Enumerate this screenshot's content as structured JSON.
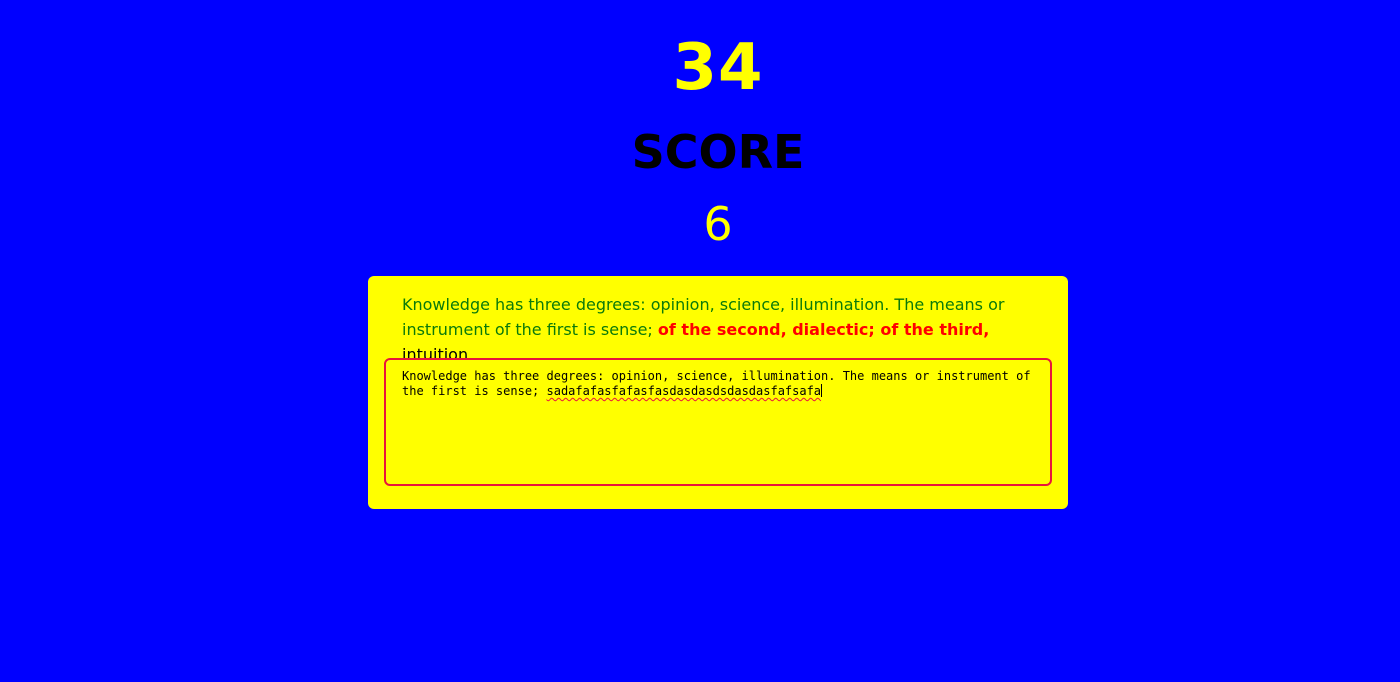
{
  "timer": {
    "value": "34"
  },
  "score": {
    "label": "SCORE",
    "value": "6"
  },
  "quote": {
    "correct_text": "Knowledge has three degrees: opinion, science, illumination. The means or instrument of the first is sense; ",
    "error_text": "of the second, dialectic; of the third,",
    "remaining_text": " intuition."
  },
  "input": {
    "typed_prefix": "Knowledge has three degrees: opinion, science, illumination. The means or instrument of the first is sense; ",
    "typed_error": "sadafafasfafasfasdasdasdsdasdasfafsafa"
  },
  "colors": {
    "background": "#0000ff",
    "accent": "#ffff00",
    "correct": "#008000",
    "error": "#ff0000",
    "input_border": "#e8143c"
  }
}
